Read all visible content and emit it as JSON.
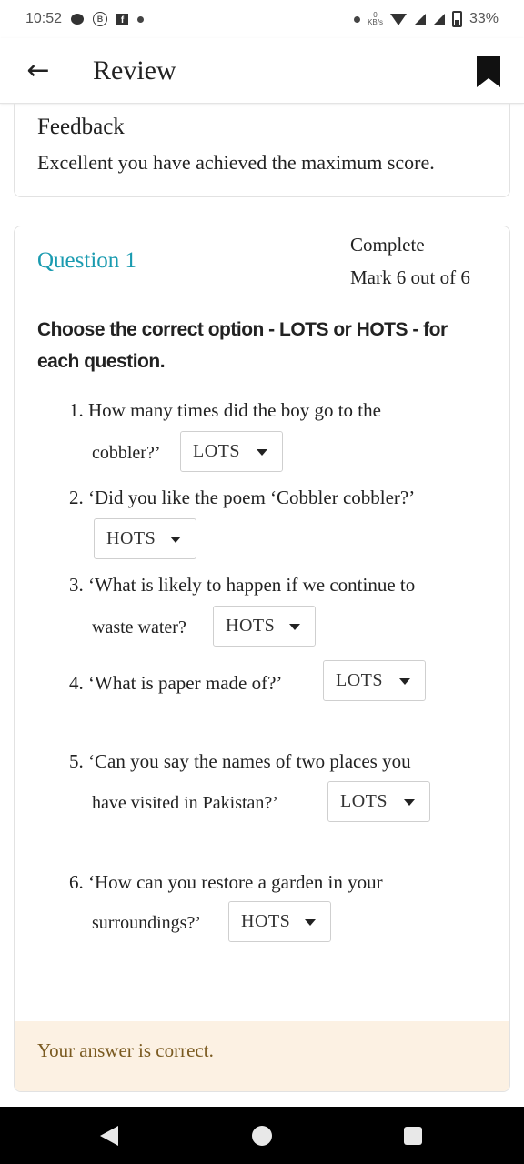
{
  "status_bar": {
    "time": "10:52",
    "net_speed_value": "0",
    "net_speed_unit": "KB/s",
    "battery": "33%"
  },
  "app_bar": {
    "title": "Review",
    "back_icon": "arrow-left-icon",
    "bookmark_icon": "bookmark-icon"
  },
  "feedback": {
    "title": "Feedback",
    "text": "Excellent you have achieved the maximum score."
  },
  "question": {
    "number": "Question 1",
    "status": "Complete",
    "mark": "Mark 6 out of 6",
    "instruction": "Choose the correct option - LOTS or HOTS - for each question.",
    "items": [
      {
        "line1": "1. How many times did the boy go to the",
        "line2": "cobbler?’",
        "answer": "LOTS"
      },
      {
        "line1": "2. ‘Did you like the poem ‘Cobbler cobbler?’",
        "line2": "",
        "answer": "HOTS"
      },
      {
        "line1": "3. ‘What is likely to happen if we continue to",
        "line2": "waste water?",
        "answer": "HOTS"
      },
      {
        "line1": "4. ‘What is paper made of?’",
        "line2": "",
        "answer": "LOTS"
      },
      {
        "line1": "5. ‘Can you say the names of two places you",
        "line2": "have visited in Pakistan?’",
        "answer": "LOTS"
      },
      {
        "line1": "6. ‘How can you restore a garden in your",
        "line2": "surroundings?’",
        "answer": "HOTS"
      }
    ],
    "answer_feedback": "Your answer is correct."
  },
  "colors": {
    "question_number": "#1a9bb0",
    "answer_feedback_bg": "#fcf1e3",
    "answer_feedback_text": "#7a5a20"
  }
}
